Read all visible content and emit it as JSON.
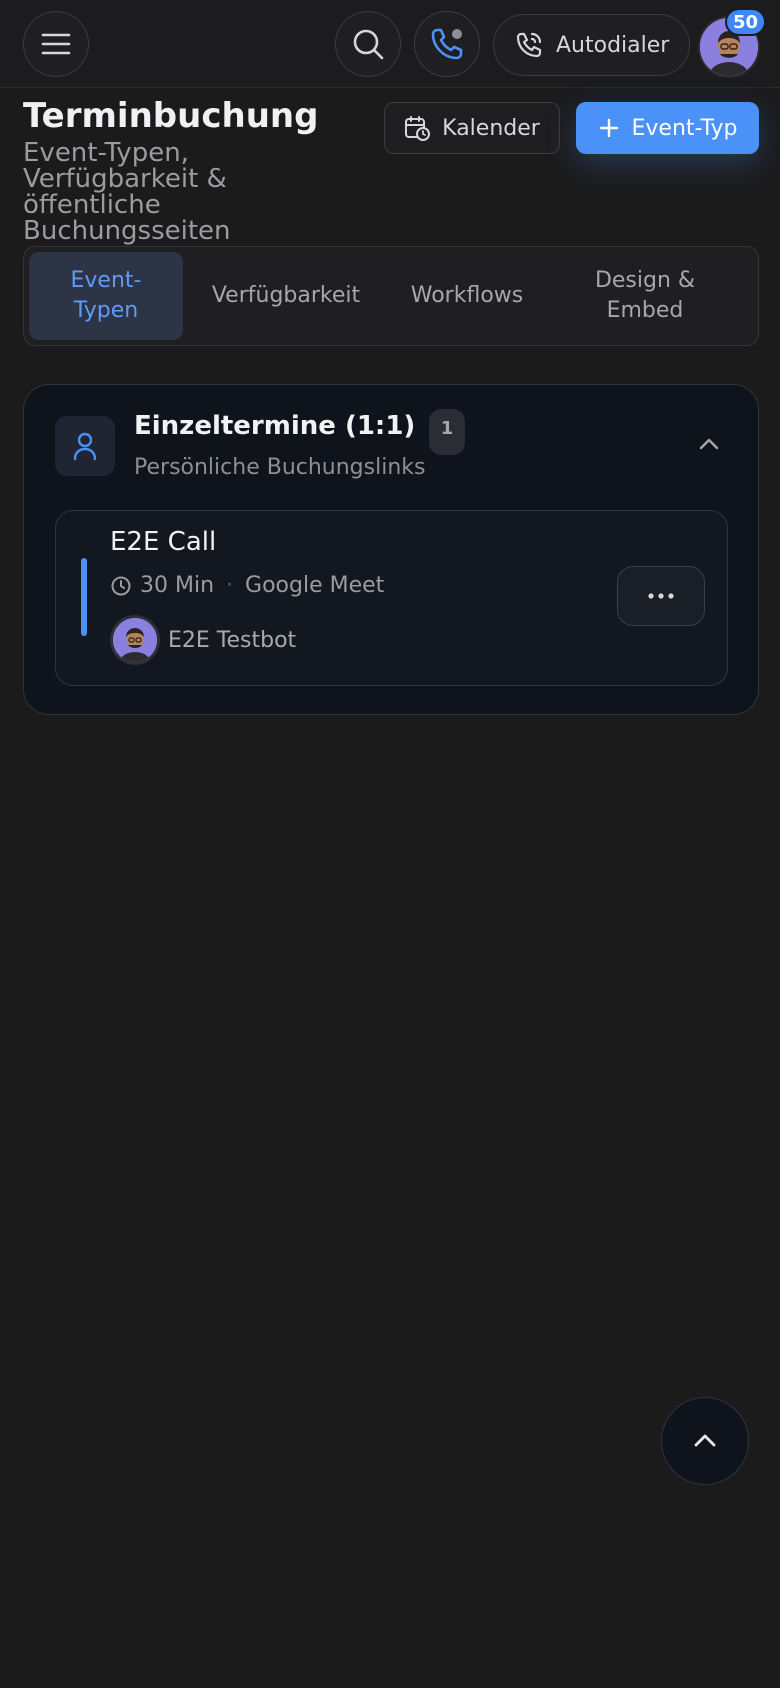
{
  "topbar": {
    "menu_icon": "menu-icon",
    "search_icon": "search-icon",
    "phone_icon": "phone-status-icon",
    "autodialer_label": "Autodialer",
    "notification_count": "50"
  },
  "header": {
    "title": "Terminbuchung",
    "subtitle": "Event-Typen, Verfügbarkeit & öffentliche Buchungsseiten",
    "calendar_button": "Kalender",
    "new_event_button": "Event-Typ"
  },
  "tabs": [
    {
      "label": "Event-Typen",
      "active": true
    },
    {
      "label": "Verfügbarkeit",
      "active": false
    },
    {
      "label": "Workflows",
      "active": false
    },
    {
      "label": "Design & Embed",
      "active": false
    }
  ],
  "group": {
    "title": "Einzeltermine (1:1)",
    "count": "1",
    "subtitle": "Persönliche Buchungslinks"
  },
  "event": {
    "title": "E2E Call",
    "duration": "30 Min",
    "separator": "·",
    "location": "Google Meet",
    "host": "E2E Testbot",
    "accent_color": "#4a92f8"
  },
  "colors": {
    "accent": "#4a92f8",
    "background": "#1b1b1c",
    "card": "#0f131c"
  }
}
